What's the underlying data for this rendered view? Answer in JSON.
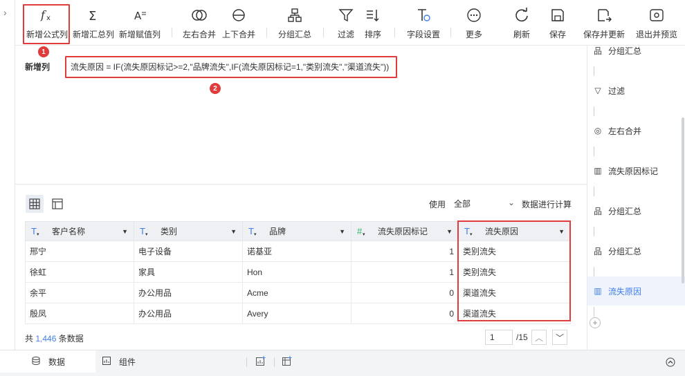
{
  "toolbar": {
    "buttons": [
      {
        "key": "new-formula-column",
        "label": "新增公式列",
        "icon": "fx-icon"
      },
      {
        "key": "new-summary-column",
        "label": "新增汇总列",
        "icon": "sigma-icon"
      },
      {
        "key": "new-assign-column",
        "label": "新增赋值列",
        "icon": "assign-icon"
      },
      {
        "key": "left-right-merge",
        "label": "左右合并",
        "icon": "venn-icon"
      },
      {
        "key": "up-down-merge",
        "label": "上下合并",
        "icon": "stack-merge-icon"
      },
      {
        "key": "group-summary",
        "label": "分组汇总",
        "icon": "group-tree-icon"
      },
      {
        "key": "filter",
        "label": "过滤",
        "icon": "funnel-icon"
      },
      {
        "key": "sort",
        "label": "排序",
        "icon": "sort-icon"
      },
      {
        "key": "field-settings",
        "label": "字段设置",
        "icon": "field-settings-icon"
      },
      {
        "key": "more",
        "label": "更多",
        "icon": "more-icon"
      },
      {
        "key": "refresh",
        "label": "刷新",
        "icon": "refresh-icon"
      },
      {
        "key": "save",
        "label": "保存",
        "icon": "save-icon"
      },
      {
        "key": "save-and-update",
        "label": "保存并更新",
        "icon": "save-update-icon"
      },
      {
        "key": "exit-preview",
        "label": "退出并预览",
        "icon": "eye-icon"
      }
    ]
  },
  "annotations": {
    "badge1": "1",
    "badge2": "2"
  },
  "formula": {
    "label": "新增列",
    "expression": "流失原因 = IF(流失原因标记>=2,\"品牌流失\",IF(流失原因标记=1,\"类别流失\",\"渠道流失\"))"
  },
  "data_panel": {
    "use_label": "使用",
    "use_value": "全部",
    "use_after": "数据进行计算"
  },
  "table": {
    "columns": [
      {
        "name": "客户名称",
        "type": "text"
      },
      {
        "name": "类别",
        "type": "text"
      },
      {
        "name": "品牌",
        "type": "text"
      },
      {
        "name": "流失原因标记",
        "type": "number"
      },
      {
        "name": "流失原因",
        "type": "text"
      }
    ],
    "rows": [
      [
        "邢宁",
        "电子设备",
        "诺基亚",
        "1",
        "类别流失"
      ],
      [
        "徐虹",
        "家具",
        "Hon",
        "1",
        "类别流失"
      ],
      [
        "余平",
        "办公用品",
        "Acme",
        "0",
        "渠道流失"
      ],
      [
        "殷凤",
        "办公用品",
        "Avery",
        "0",
        "渠道流失"
      ]
    ]
  },
  "footer": {
    "total_prefix": "共",
    "total_count": "1,446",
    "total_suffix": "条数据",
    "page_value": "1",
    "page_total": "/15"
  },
  "steps": [
    {
      "label": "分组汇总",
      "icon": "group-tree-icon"
    },
    {
      "label": "过滤",
      "icon": "funnel-icon"
    },
    {
      "label": "左右合并",
      "icon": "venn-icon"
    },
    {
      "label": "流失原因标记",
      "icon": "column-icon"
    },
    {
      "label": "分组汇总",
      "icon": "group-tree-icon"
    },
    {
      "label": "分组汇总",
      "icon": "group-tree-icon"
    },
    {
      "label": "流失原因",
      "icon": "column-icon"
    }
  ],
  "bottom_tabs": [
    {
      "label": "数据",
      "icon": "database-icon"
    },
    {
      "label": "组件",
      "icon": "chart-icon"
    }
  ],
  "colors": {
    "accent": "#3f7ee8",
    "highlight": "#e23b3b",
    "number_type": "#2fb56a"
  }
}
